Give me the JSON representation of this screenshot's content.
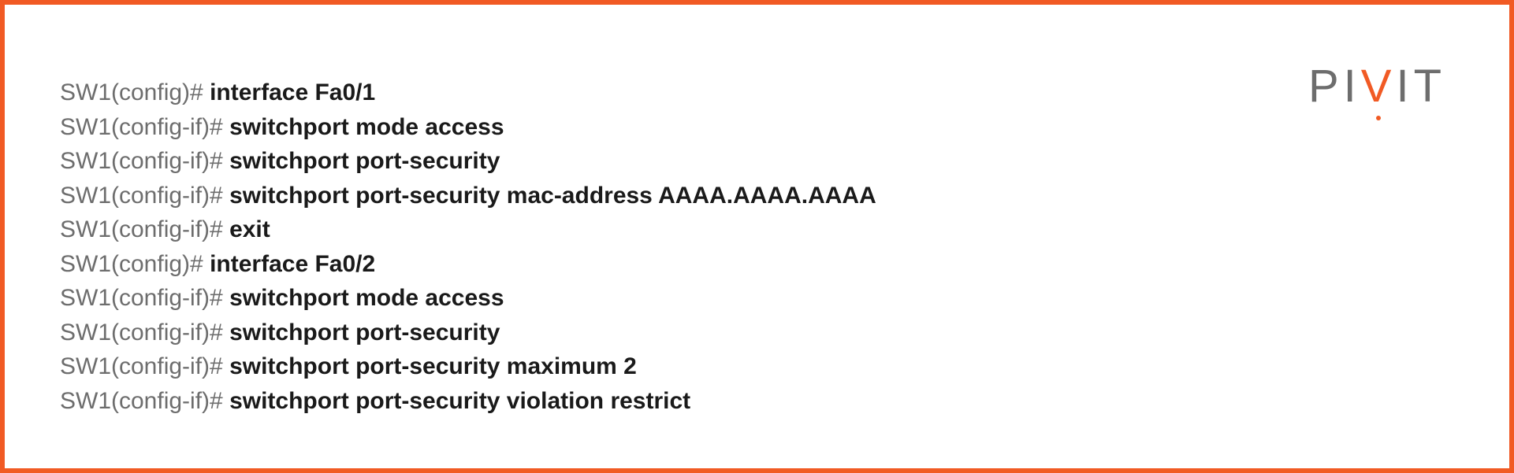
{
  "brand": {
    "segment_left": "PI",
    "segment_v": "V",
    "segment_right": "IT",
    "accent_color": "#f15a24",
    "muted_color": "#6d6d6d"
  },
  "cli_lines": [
    {
      "prompt": "SW1(config)# ",
      "command": "interface Fa0/1"
    },
    {
      "prompt": "SW1(config-if)# ",
      "command": "switchport mode access"
    },
    {
      "prompt": "SW1(config-if)# ",
      "command": "switchport port-security"
    },
    {
      "prompt": "SW1(config-if)# ",
      "command": "switchport port-security mac-address AAAA.AAAA.AAAA"
    },
    {
      "prompt": "SW1(config-if)# ",
      "command": "exit"
    },
    {
      "prompt": "SW1(config)# ",
      "command": "interface Fa0/2"
    },
    {
      "prompt": "SW1(config-if)# ",
      "command": "switchport mode access"
    },
    {
      "prompt": "SW1(config-if)# ",
      "command": "switchport port-security"
    },
    {
      "prompt": "SW1(config-if)# ",
      "command": "switchport port-security maximum 2"
    },
    {
      "prompt": "SW1(config-if)# ",
      "command": "switchport port-security violation restrict"
    }
  ]
}
